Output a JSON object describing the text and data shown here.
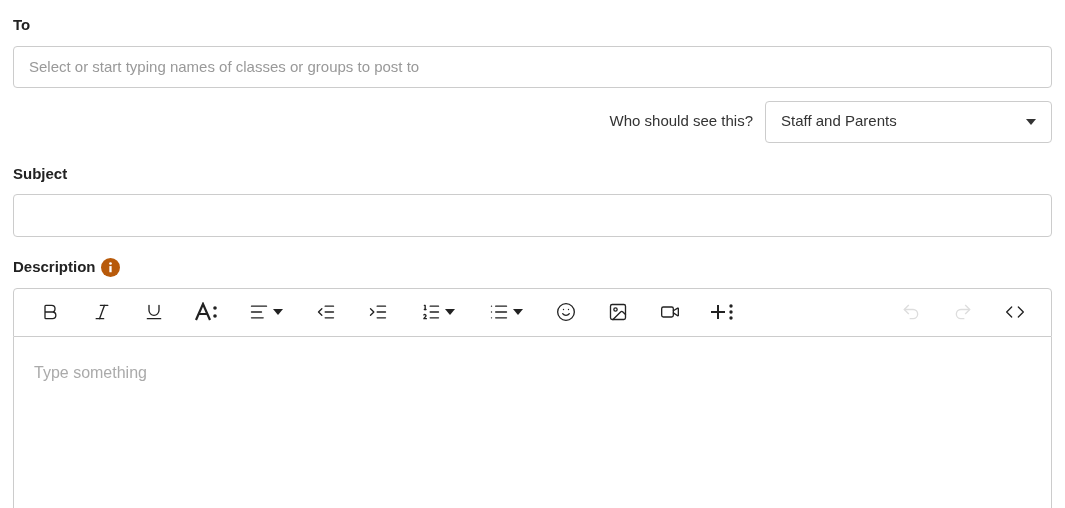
{
  "to": {
    "label": "To",
    "placeholder": "Select or start typing names of classes or groups to post to"
  },
  "audience": {
    "label": "Who should see this?",
    "value": "Staff and Parents"
  },
  "subject": {
    "label": "Subject"
  },
  "description": {
    "label": "Description",
    "placeholder": "Type something"
  },
  "toolbar": [
    {
      "kind": "bold",
      "dropdown": false,
      "disabled": false
    },
    {
      "kind": "italic",
      "dropdown": false,
      "disabled": false
    },
    {
      "kind": "underline",
      "dropdown": false,
      "disabled": false
    },
    {
      "kind": "font-size",
      "dropdown": false,
      "disabled": false
    },
    {
      "kind": "align",
      "dropdown": true,
      "disabled": false
    },
    {
      "kind": "outdent",
      "dropdown": false,
      "disabled": false
    },
    {
      "kind": "indent",
      "dropdown": false,
      "disabled": false
    },
    {
      "kind": "ordered-list",
      "dropdown": true,
      "disabled": false
    },
    {
      "kind": "bullet-list",
      "dropdown": true,
      "disabled": false
    },
    {
      "kind": "emoji",
      "dropdown": false,
      "disabled": false
    },
    {
      "kind": "image",
      "dropdown": false,
      "disabled": false
    },
    {
      "kind": "video",
      "dropdown": false,
      "disabled": false
    },
    {
      "kind": "insert",
      "dropdown": false,
      "disabled": false
    },
    {
      "kind": "spacer"
    },
    {
      "kind": "undo",
      "dropdown": false,
      "disabled": true
    },
    {
      "kind": "redo",
      "dropdown": false,
      "disabled": true
    },
    {
      "kind": "code",
      "dropdown": false,
      "disabled": false
    }
  ]
}
